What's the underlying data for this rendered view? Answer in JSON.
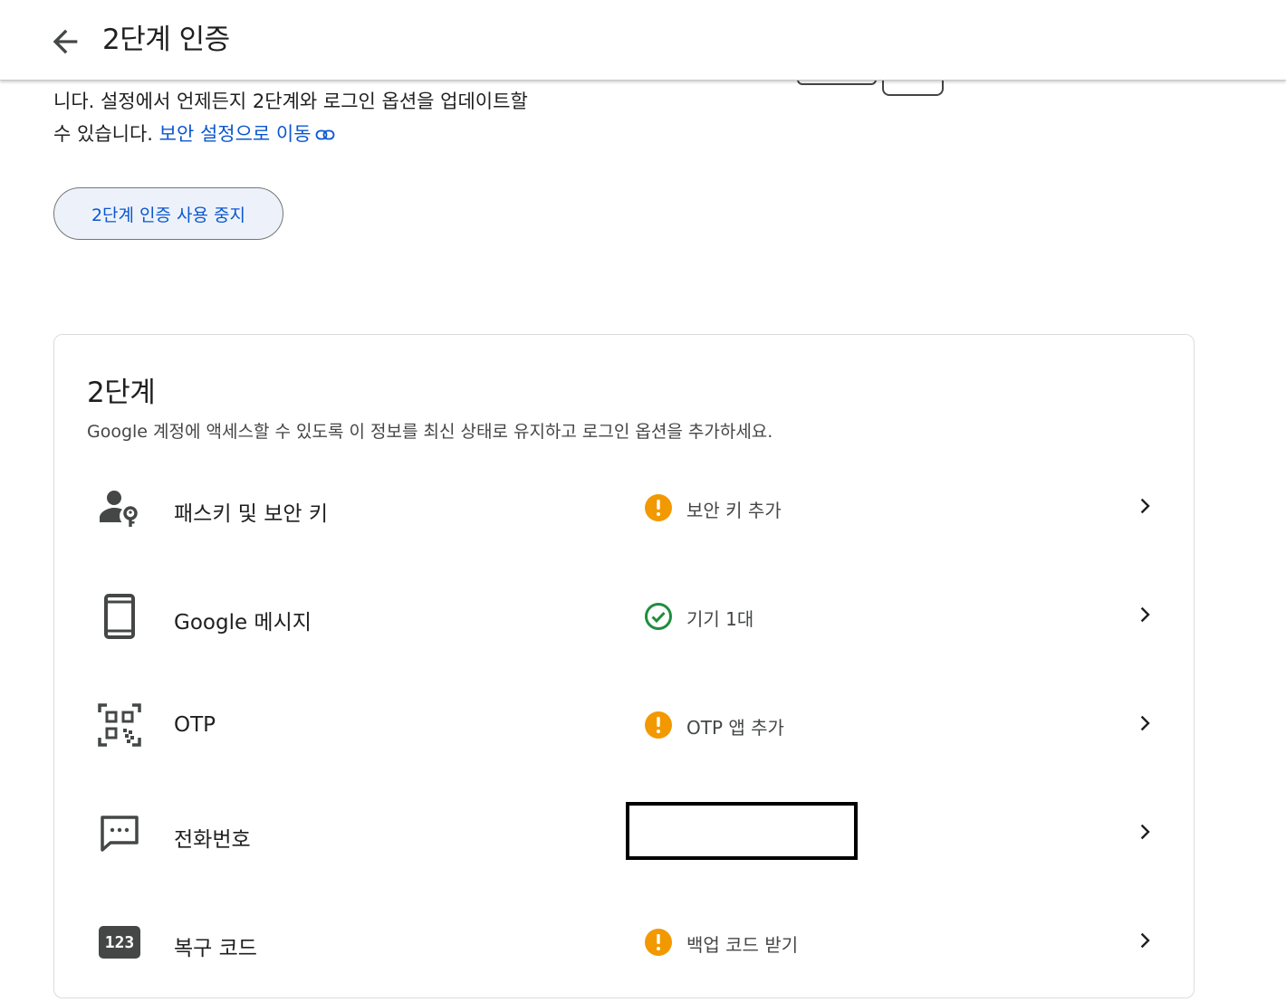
{
  "header": {
    "title": "2단계 인증"
  },
  "intro": {
    "line1": "니다. 설정에서 언제든지 2단계와 로그인 옵션을 업데이트할",
    "line2": "수 있습니다. ",
    "link": "보안 설정으로 이동"
  },
  "disable_button": "2단계 인증 사용 중지",
  "card": {
    "title": "2단계",
    "subtitle": "Google 계정에 액세스할 수 있도록 이 정보를 최신 상태로 유지하고 로그인 옵션을 추가하세요.",
    "rows": [
      {
        "label": "패스키 및 보안 키",
        "icon": "passkey-icon",
        "status": "보안 키 추가",
        "status_type": "warning"
      },
      {
        "label": "Google 메시지",
        "icon": "phone-icon",
        "status": "기기 1대",
        "status_type": "ok"
      },
      {
        "label": "OTP",
        "icon": "qr-code-icon",
        "status": "OTP 앱 추가",
        "status_type": "warning"
      },
      {
        "label": "전화번호",
        "icon": "message-icon",
        "status": "",
        "status_type": "redacted"
      },
      {
        "label": "복구 코드",
        "icon": "backup-code-icon",
        "icon_text": "123",
        "status": "백업 코드 받기",
        "status_type": "warning"
      }
    ]
  },
  "colors": {
    "link": "#0b57d0",
    "warning": "#f29900",
    "ok": "#1e8e3e"
  }
}
